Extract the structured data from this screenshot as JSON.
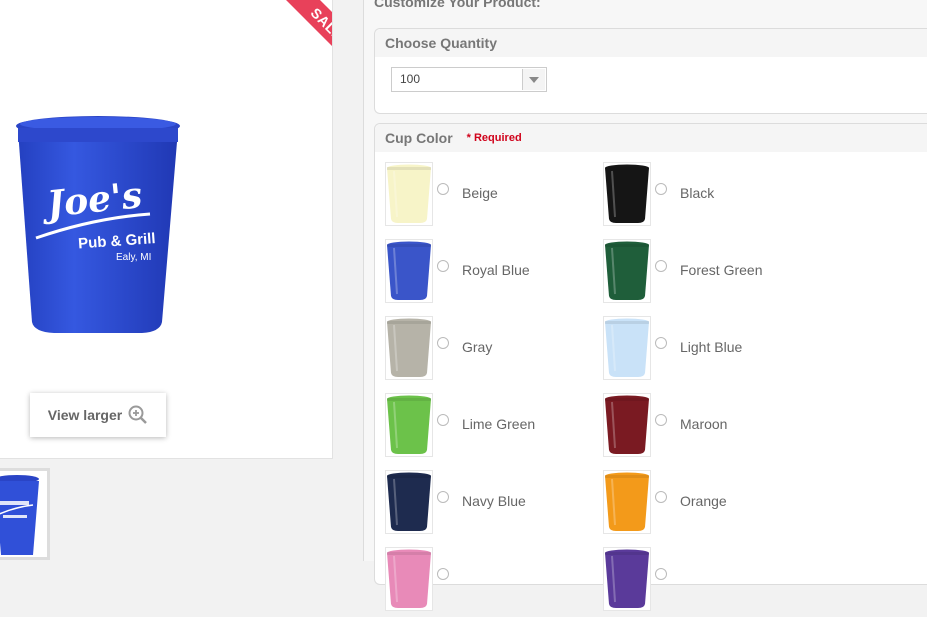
{
  "product": {
    "sale_badge": "SALE!",
    "view_larger_label": "View larger",
    "cup_color": "#2f4fd6",
    "logo_title": "Joe's",
    "logo_subtitle": "Pub & Grill",
    "logo_location": "Ealy, MI"
  },
  "customize": {
    "title": "Customize Your Product:",
    "quantity": {
      "header": "Choose Quantity",
      "selected": "100"
    },
    "cup_color": {
      "header": "Cup Color",
      "required_label": "* Required",
      "options": [
        {
          "label": "Beige",
          "color": "#f7f4c8"
        },
        {
          "label": "Black",
          "color": "#151515"
        },
        {
          "label": "Royal Blue",
          "color": "#3a55c9"
        },
        {
          "label": "Forest Green",
          "color": "#1f5e3a"
        },
        {
          "label": "Gray",
          "color": "#b6b3a8"
        },
        {
          "label": "Light Blue",
          "color": "#c9e2f8"
        },
        {
          "label": "Lime Green",
          "color": "#6cc24a"
        },
        {
          "label": "Maroon",
          "color": "#7a1a22"
        },
        {
          "label": "Navy Blue",
          "color": "#1e2b4f"
        },
        {
          "label": "Orange",
          "color": "#f39a1a"
        },
        {
          "label": "",
          "color": "#e88ab8"
        },
        {
          "label": "",
          "color": "#5a3a9a"
        }
      ]
    }
  }
}
